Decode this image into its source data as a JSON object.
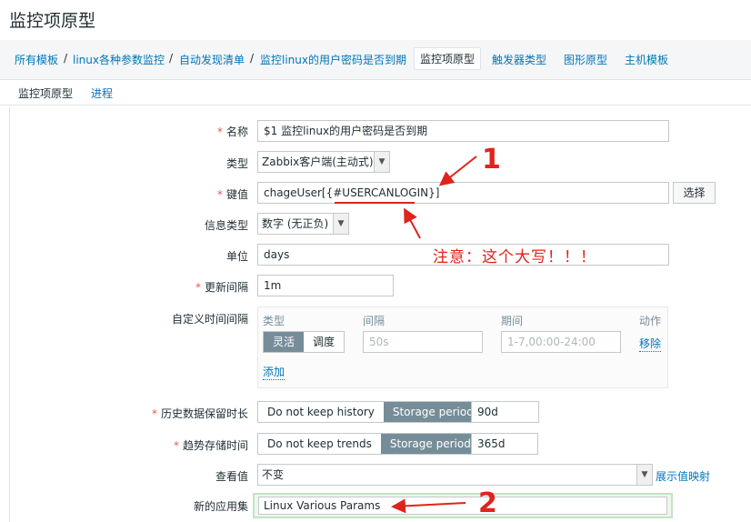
{
  "page": {
    "title": "监控项原型"
  },
  "breadcrumb": {
    "items": [
      "所有模板",
      "linux各种参数监控",
      "自动发现清单",
      "监控linux的用户密码是否到期"
    ],
    "active": "监控项原型",
    "links": [
      "触发器类型",
      "图形原型",
      "主机模板"
    ]
  },
  "tabs": {
    "active": "监控项原型",
    "other": "进程"
  },
  "form": {
    "name": {
      "label": "名称",
      "value": "$1 监控linux的用户密码是否到期"
    },
    "type": {
      "label": "类型",
      "value": "Zabbix客户端(主动式)"
    },
    "key": {
      "label": "键值",
      "value": "chageUser[{#USERCANLOGIN}]",
      "select_button": "选择"
    },
    "info_type": {
      "label": "信息类型",
      "value": "数字 (无正负)"
    },
    "units": {
      "label": "单位",
      "value": "days"
    },
    "update_interval": {
      "label": "更新间隔",
      "value": "1m"
    },
    "custom_intervals": {
      "label": "自定义时间间隔",
      "col_type": "类型",
      "col_interval": "间隔",
      "col_period": "期间",
      "col_action": "动作",
      "type_flexible": "灵活",
      "type_scheduling": "调度",
      "interval_placeholder": "50s",
      "period_placeholder": "1-7,00:00-24:00",
      "remove": "移除",
      "add": "添加"
    },
    "history": {
      "label": "历史数据保留时长",
      "opt_off": "Do not keep history",
      "opt_on": "Storage period",
      "value": "90d"
    },
    "trends": {
      "label": "趋势存储时间",
      "opt_off": "Do not keep trends",
      "opt_on": "Storage period",
      "value": "365d"
    },
    "show_value": {
      "label": "查看值",
      "value": "不变",
      "mapping_link": "展示值映射"
    },
    "new_application": {
      "label": "新的应用集",
      "value": "Linux Various Params"
    }
  },
  "annotations": {
    "note": "注意：这个大写！！！",
    "mark1": "1",
    "mark2": "2"
  },
  "colors": {
    "accent": "#0275b8",
    "required": "#e45959",
    "annotation": "#e0231c",
    "segment_on": "#768d99"
  }
}
